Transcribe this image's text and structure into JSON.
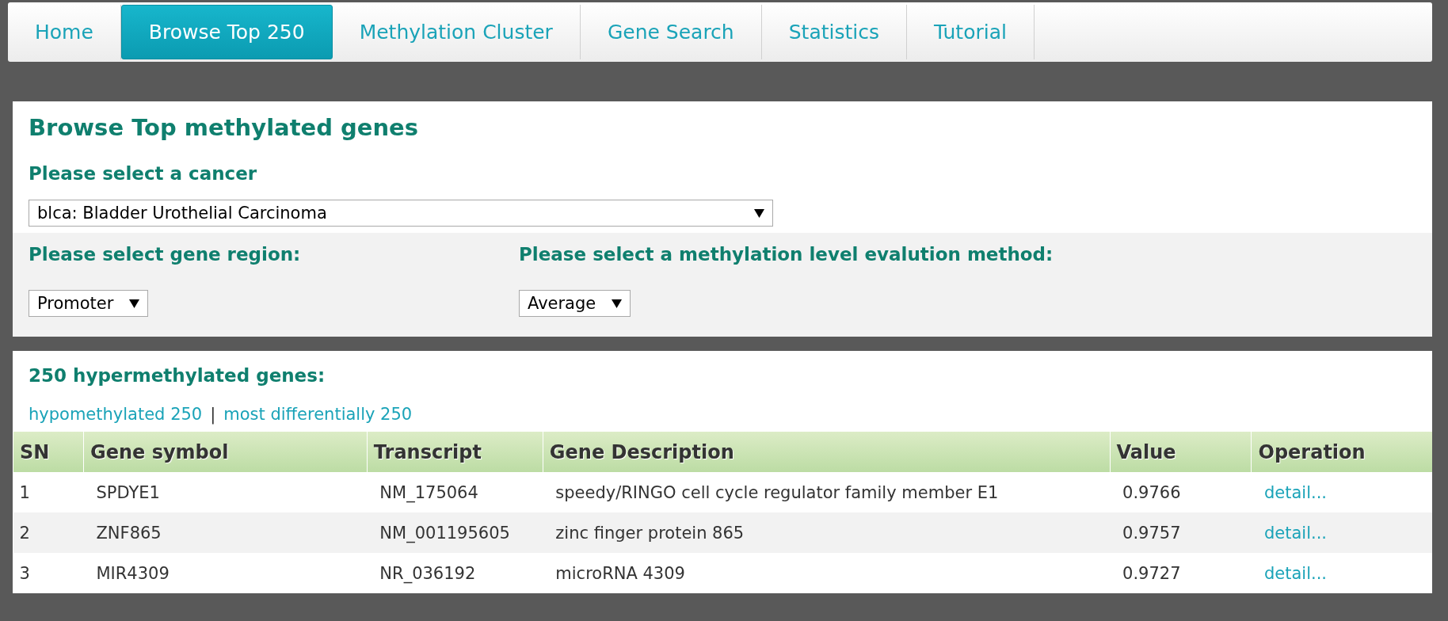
{
  "nav": {
    "tabs": [
      {
        "label": "Home",
        "selected": false
      },
      {
        "label": "Browse Top 250",
        "selected": true
      },
      {
        "label": "Methylation Cluster",
        "selected": false
      },
      {
        "label": "Gene Search",
        "selected": false
      },
      {
        "label": "Statistics",
        "selected": false
      },
      {
        "label": "Tutorial",
        "selected": false
      }
    ]
  },
  "selection_panel": {
    "title": "Browse Top methylated genes",
    "cancer_label": "Please select a cancer",
    "cancer_select": {
      "value": "blca: Bladder Urothelial Carcinoma"
    },
    "region_label": "Please select gene region:",
    "region_select": {
      "value": "Promoter"
    },
    "method_label": "Please select a methylation level evalution method:",
    "method_select": {
      "value": "Average"
    }
  },
  "results": {
    "heading": "250 hypermethylated genes:",
    "links": [
      "hypomethylated 250",
      "most differentially 250"
    ],
    "separator": "|",
    "table": {
      "columns": [
        "SN",
        "Gene symbol",
        "Transcript",
        "Gene Description",
        "Value",
        "Operation"
      ],
      "rows": [
        [
          "1",
          "SPDYE1",
          "NM_175064",
          "speedy/RINGO cell cycle regulator family member E1",
          "0.9766",
          "detail..."
        ],
        [
          "2",
          "ZNF865",
          "NM_001195605",
          "zinc finger protein 865",
          "0.9757",
          "detail..."
        ],
        [
          "3",
          "MIR4309",
          "NR_036192",
          "microRNA 4309",
          "0.9727",
          "detail..."
        ]
      ]
    }
  }
}
